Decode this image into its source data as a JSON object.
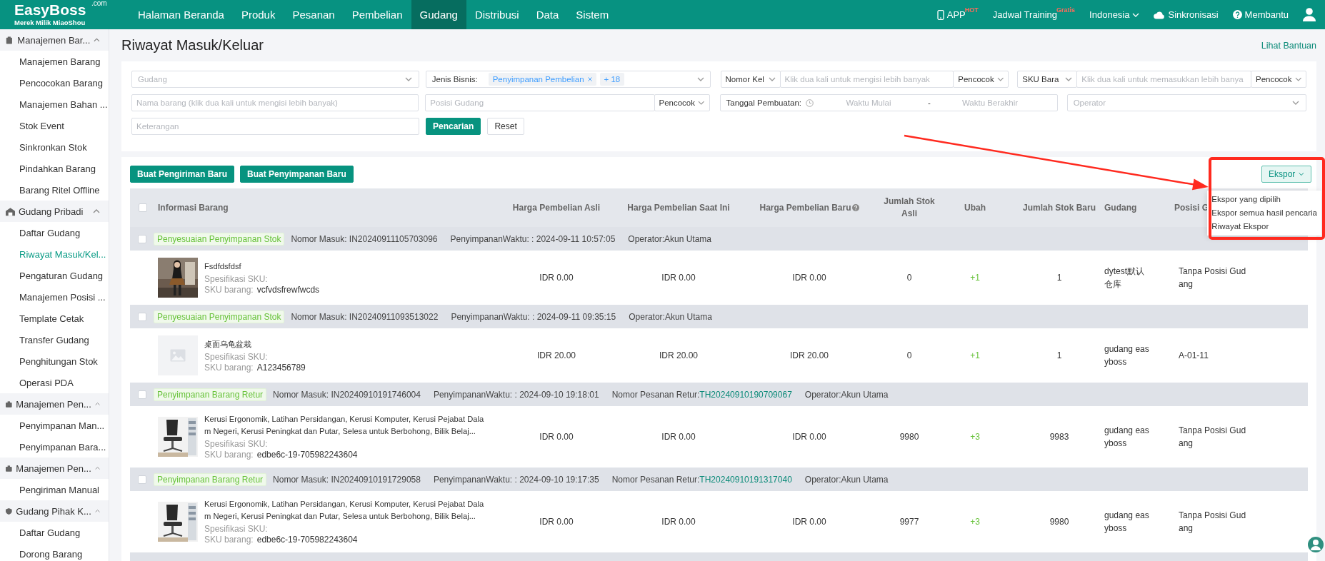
{
  "brand": {
    "name": "EasyBoss",
    "domain": ".com",
    "tagline": "Merek Milik MiaoShou"
  },
  "nav": [
    {
      "label": "Halaman Beranda",
      "selected": false
    },
    {
      "label": "Produk",
      "selected": false
    },
    {
      "label": "Pesanan",
      "selected": false
    },
    {
      "label": "Pembelian",
      "selected": false
    },
    {
      "label": "Gudang",
      "selected": true
    },
    {
      "label": "Distribusi",
      "selected": false
    },
    {
      "label": "Data",
      "selected": false
    },
    {
      "label": "Sistem",
      "selected": false
    }
  ],
  "top_links": [
    {
      "kind": "app",
      "label": "APP",
      "badge": "HOT"
    },
    {
      "kind": "training",
      "label": "Jadwal Training",
      "badge": "Gratis"
    },
    {
      "kind": "language",
      "label": "Indonesia"
    },
    {
      "kind": "sync",
      "label": "Sinkronisasi"
    },
    {
      "kind": "help",
      "label": "Membantu"
    },
    {
      "kind": "user"
    }
  ],
  "sidebar": [
    {
      "kind": "goods",
      "label": "Manajemen Bar...",
      "expanded": true,
      "children": [
        {
          "label": "Manajemen Barang",
          "selected": false
        },
        {
          "label": "Pencocokan Barang",
          "selected": false
        },
        {
          "label": "Manajemen Bahan ...",
          "selected": false
        },
        {
          "label": "Stok Event",
          "selected": false
        },
        {
          "label": "Sinkronkan Stok",
          "selected": false
        },
        {
          "label": "Pindahkan Barang",
          "selected": false
        },
        {
          "label": "Barang Ritel Offline",
          "selected": false
        }
      ]
    },
    {
      "kind": "warehouse",
      "label": "Gudang Pribadi",
      "expanded": true,
      "children": [
        {
          "label": "Daftar Gudang",
          "selected": false
        },
        {
          "label": "Riwayat Masuk/Kel...",
          "selected": true
        },
        {
          "label": "Pengaturan Gudang",
          "selected": false
        },
        {
          "label": "Manajemen Posisi ...",
          "selected": false
        },
        {
          "label": "Template Cetak",
          "selected": false
        },
        {
          "label": "Transfer Gudang",
          "selected": false
        },
        {
          "label": "Penghitungan Stok",
          "selected": false
        },
        {
          "label": "Operasi PDA",
          "selected": false
        }
      ]
    },
    {
      "kind": "inbound",
      "label": "Manajemen Pen...",
      "expanded": true,
      "children": [
        {
          "label": "Penyimpanan Man...",
          "selected": false
        },
        {
          "label": "Penyimpanan Bara...",
          "selected": false
        }
      ]
    },
    {
      "kind": "outbound",
      "label": "Manajemen Pen...",
      "expanded": true,
      "children": [
        {
          "label": "Pengiriman Manual",
          "selected": false
        }
      ]
    },
    {
      "kind": "third_party",
      "label": "Gudang Pihak K...",
      "expanded": true,
      "children": [
        {
          "label": "Daftar Gudang",
          "selected": false
        },
        {
          "label": "Dorong Barang",
          "selected": false
        }
      ]
    }
  ],
  "page": {
    "title": "Riwayat Masuk/Keluar",
    "help_link": "Lihat Bantuan"
  },
  "filters": [
    [
      {
        "kind": "select",
        "placeholder": "Gudang"
      },
      {
        "kind": "tags",
        "label": "Jenis Bisnis:",
        "tags": [
          "Penyimpanan Pembelian"
        ],
        "more": "+ 18"
      },
      {
        "kind": "combo",
        "select": "Nomor Kel",
        "placeholder": "Klik dua kali untuk mengisi lebih banyak",
        "match": "Pencocok"
      },
      {
        "kind": "combo",
        "select": "SKU Bara",
        "placeholder": "Klik dua kali untuk memasukkan lebih banya",
        "match": "Pencocok"
      }
    ],
    [
      {
        "kind": "input",
        "placeholder": "Nama barang (klik dua kali untuk mengisi lebih banyak)"
      },
      {
        "kind": "input_match",
        "placeholder": "Posisi Gudang",
        "match": "Pencocok"
      },
      {
        "kind": "date_range",
        "label": "Tanggal Pembuatan:",
        "start": {
          "placeholder": "Waktu Mulai"
        },
        "separator": "-",
        "end": {
          "placeholder": "Waktu Berakhir"
        }
      },
      {
        "kind": "select",
        "placeholder": "Operator"
      }
    ],
    [
      {
        "kind": "input",
        "placeholder": "Keterangan"
      },
      {
        "kind": "primary_button",
        "label": "Pencarian"
      },
      {
        "kind": "button",
        "label": "Reset"
      }
    ]
  ],
  "toolbar": {
    "buttons": [
      "Buat Pengiriman Baru",
      "Buat Penyimpanan Baru"
    ],
    "export": {
      "label": "Ekspor",
      "open": true,
      "items": [
        "Ekspor yang dipilih",
        "Ekspor semua hasil pencaria",
        "Riwayat Ekspor"
      ]
    }
  },
  "table": {
    "header_checked": false,
    "columns": [
      {
        "label": "Informasi Barang",
        "help": false
      },
      {
        "label": "Harga Pembelian Asli",
        "help": false
      },
      {
        "label": "Harga Pembelian Saat Ini",
        "help": false
      },
      {
        "label": "Harga Pembelian Baru",
        "help": true
      },
      {
        "label": "Jumlah Stok Asli",
        "help": false
      },
      {
        "label": "Ubah",
        "help": false
      },
      {
        "label": "Jumlah Stok Baru",
        "help": false
      },
      {
        "label": "Gudang",
        "help": false
      },
      {
        "label": "Posisi G",
        "help": false
      }
    ],
    "groups": [
      {
        "checked": false,
        "tag": "Penyesuaian Penyimpanan Stok",
        "meta": [
          {
            "text": "Nomor Masuk: IN20240911105703096"
          },
          {
            "text": "PenyimpananWaktu: : 2024-09-11 10:57:05"
          },
          {
            "text": "Operator:Akun Utama"
          }
        ],
        "item": {
          "photo": true,
          "name": "Fsdfdsfdsf",
          "spec_label": "Spesifikasi SKU:",
          "sku_label": "SKU barang:",
          "sku": "vcfvdsfrewfwcds",
          "price_original": "IDR 0.00",
          "price_current": "IDR 0.00",
          "price_new": "IDR 0.00",
          "stock_original": "0",
          "change": "+1",
          "stock_new": "1",
          "warehouse": "dytest默认仓库",
          "position": "Tanpa Posisi Gudang"
        }
      },
      {
        "checked": false,
        "tag": "Penyesuaian Penyimpanan Stok",
        "meta": [
          {
            "text": "Nomor Masuk: IN20240911093513022"
          },
          {
            "text": "PenyimpananWaktu: : 2024-09-11 09:35:15"
          },
          {
            "text": "Operator:Akun Utama"
          }
        ],
        "item": {
          "photo": false,
          "name": "桌面乌龟盆栽",
          "spec_label": "Spesifikasi SKU:",
          "sku_label": "SKU barang:",
          "sku": "A123456789",
          "price_original": "IDR 20.00",
          "price_current": "IDR 20.00",
          "price_new": "IDR 20.00",
          "stock_original": "0",
          "change": "+1",
          "stock_new": "1",
          "warehouse": "gudang easyboss",
          "position": "A-01-11"
        }
      },
      {
        "checked": false,
        "tag": "Penyimpanan Barang Retur",
        "meta": [
          {
            "text": "Nomor Masuk: IN20240910191746004"
          },
          {
            "text": "PenyimpananWaktu: : 2024-09-10 19:18:01"
          },
          {
            "text": "Nomor Pesanan Retur:",
            "link": "TH20240910190709067"
          },
          {
            "text": "Operator:Akun Utama"
          }
        ],
        "item": {
          "photo": true,
          "name": "Kerusi Ergonomik, Latihan Persidangan, Kerusi Komputer, Kerusi Pejabat Dalam Negeri, Kerusi Peningkat dan Putar, Selesa untuk Berbohong, Bilik Belaj...",
          "spec_label": "Spesifikasi SKU:",
          "sku_label": "SKU barang:",
          "sku": "edbe6c-19-705982243604",
          "price_original": "IDR 0.00",
          "price_current": "IDR 0.00",
          "price_new": "IDR 0.00",
          "stock_original": "9980",
          "change": "+3",
          "stock_new": "9983",
          "warehouse": "gudang easyboss",
          "position": "Tanpa Posisi Gudang"
        }
      },
      {
        "checked": false,
        "tag": "Penyimpanan Barang Retur",
        "meta": [
          {
            "text": "Nomor Masuk: IN20240910191729058"
          },
          {
            "text": "PenyimpananWaktu: : 2024-09-10 19:17:35"
          },
          {
            "text": "Nomor Pesanan Retur:",
            "link": "TH20240910191317040"
          },
          {
            "text": "Operator:Akun Utama"
          }
        ],
        "item": {
          "photo": true,
          "name": "Kerusi Ergonomik, Latihan Persidangan, Kerusi Komputer, Kerusi Pejabat Dalam Negeri, Kerusi Peningkat dan Putar, Selesa untuk Berbohong, Bilik Belaj...",
          "spec_label": "Spesifikasi SKU:",
          "sku_label": "SKU barang:",
          "sku": "edbe6c-19-705982243604",
          "price_original": "IDR 0.00",
          "price_current": "IDR 0.00",
          "price_new": "IDR 0.00",
          "stock_original": "9977",
          "change": "+3",
          "stock_new": "9980",
          "warehouse": "gudang easyboss",
          "position": "Tanpa Posisi Gudang"
        }
      }
    ]
  }
}
